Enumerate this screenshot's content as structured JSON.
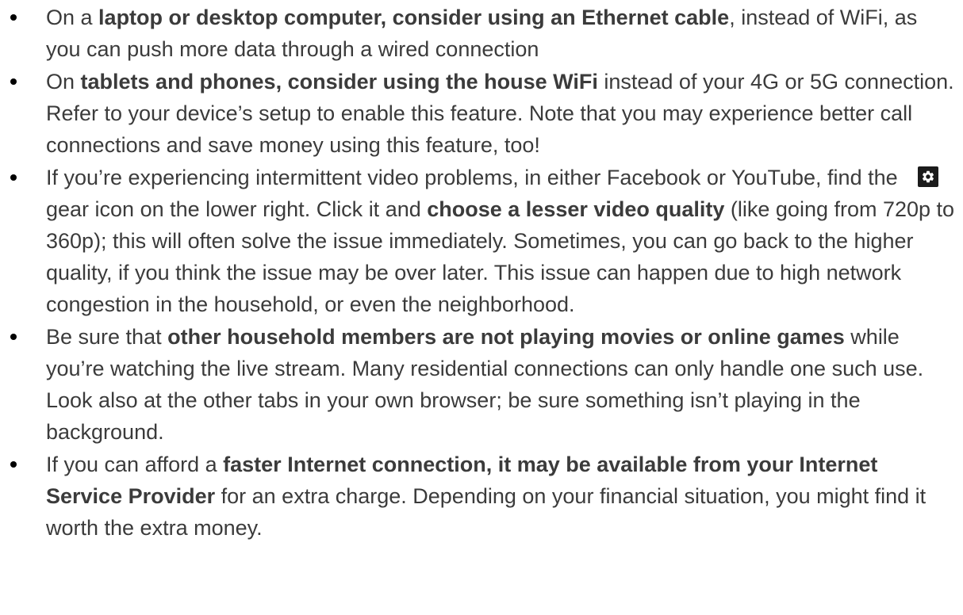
{
  "icons": {
    "bullet": "bullet-dot-icon",
    "gear": "gear-icon"
  },
  "colors": {
    "text": "#3b3b3b",
    "gear_background": "#1b1b1b",
    "gear_foreground": "#ffffff"
  },
  "bullets": [
    {
      "t1": "On a ",
      "b1": "laptop or desktop computer, consider using an Ethernet cable",
      "t2": ", instead of WiFi, as you can push more data through a wired connection"
    },
    {
      "t1": "On ",
      "b1": "tablets and phones, consider using the house WiFi",
      "t2": " instead of your 4G or 5G connection. Refer to your device’s setup to enable this feature. Note that you may experience better call connections and save money using this feature, too!"
    },
    {
      "t1": "If you’re experiencing intermittent video problems, in either Facebook or YouTube, find the",
      "t2": "gear icon on the lower right. Click it and ",
      "b1": "choose a lesser video quality",
      "t3": " (like going from 720p to 360p); this will often solve the issue immediately. Sometimes, you can go back to the higher quality, if you think the issue may be over later. This issue can happen due to high network congestion in the household, or even the neighborhood."
    },
    {
      "t1": "Be sure that ",
      "b1": "other household members are not playing movies or online games",
      "t2": " while you’re watching the live stream. Many residential connections can only handle one such use. Look also at the other tabs in your own browser; be sure something isn’t playing in the background."
    },
    {
      "t1": "If you can afford a ",
      "b1": "faster Internet connection, it may be available from your Internet Service Provider",
      "t2": " for an extra charge. Depending on your financial situation, you might find it worth the extra money."
    }
  ]
}
